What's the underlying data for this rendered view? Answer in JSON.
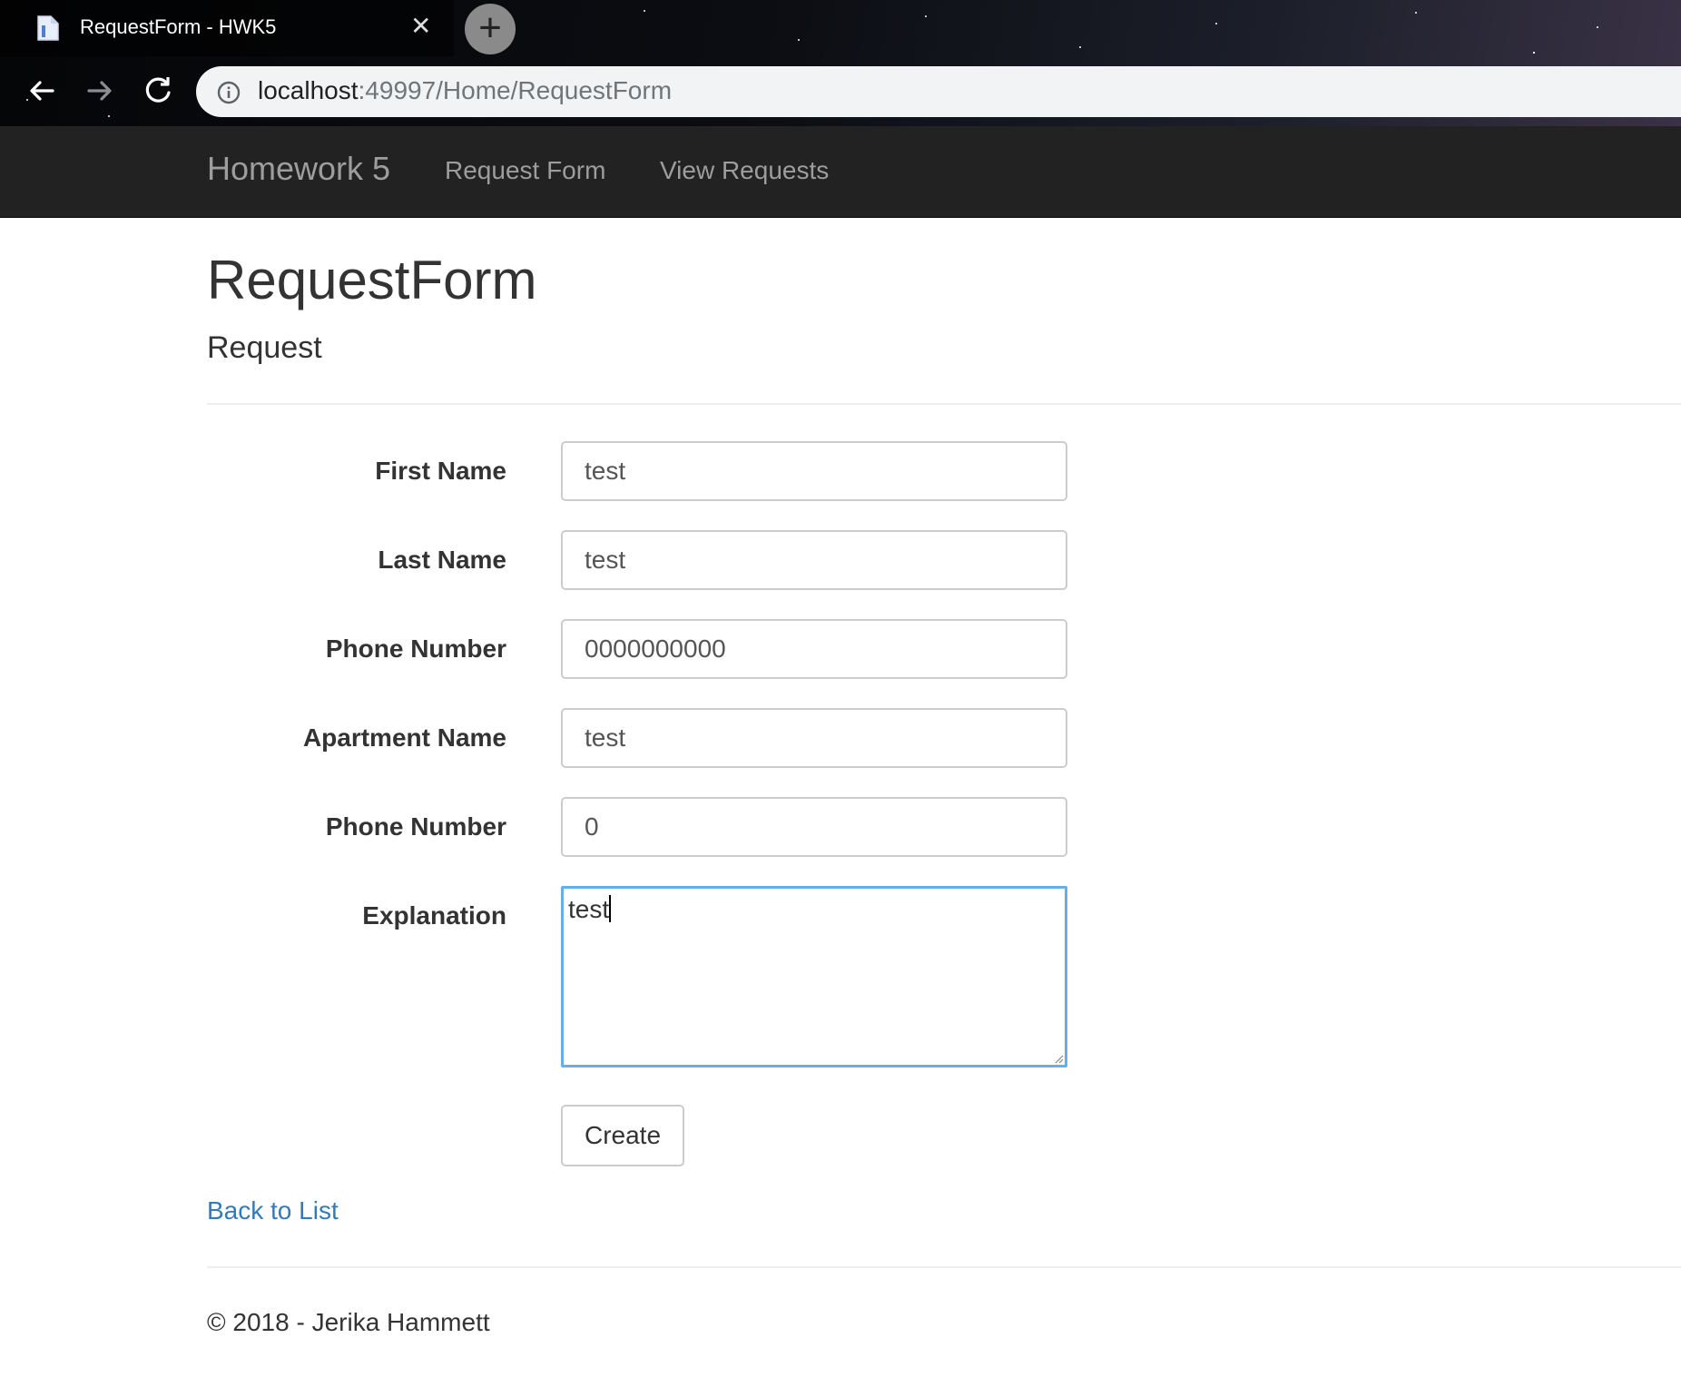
{
  "browser": {
    "tab_title": "RequestForm - HWK5",
    "tab_close": "✕",
    "new_tab": "+",
    "url_host": "localhost",
    "url_rest": ":49997/Home/RequestForm"
  },
  "navbar": {
    "brand": "Homework 5",
    "links": [
      "Request Form",
      "View Requests"
    ]
  },
  "page": {
    "title": "RequestForm",
    "subtitle": "Request"
  },
  "form": {
    "fields": [
      {
        "label": "First Name",
        "value": "test"
      },
      {
        "label": "Last Name",
        "value": "test"
      },
      {
        "label": "Phone Number",
        "value": "0000000000"
      },
      {
        "label": "Apartment Name",
        "value": "test"
      },
      {
        "label": "Phone Number",
        "value": "0"
      }
    ],
    "explanation": {
      "label": "Explanation",
      "value": "test"
    },
    "submit_label": "Create"
  },
  "back_link": "Back to List",
  "footer": "© 2018 - Jerika Hammett",
  "colors": {
    "navbar_bg": "#222222",
    "navbar_text": "#9d9d9d",
    "link": "#337ab7",
    "focus_border": "#66afe9"
  }
}
